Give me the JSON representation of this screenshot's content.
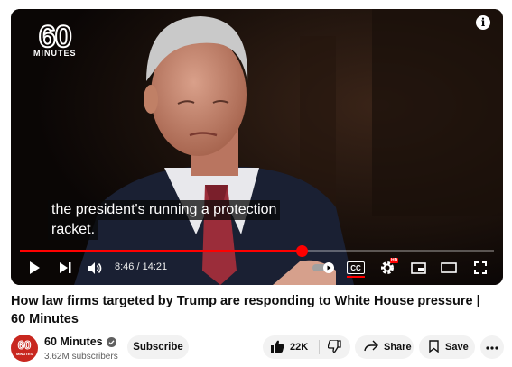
{
  "video": {
    "brand_number": "60",
    "brand_word": "MINUTES",
    "info_label": "i",
    "caption_line1": "the president's running a protection",
    "caption_line2": "racket.",
    "progress_fraction": 0.595,
    "current_time": "8:46",
    "duration": "14:21",
    "time_separator": "/",
    "cc_label": "CC",
    "hd_badge": "HD",
    "accent_color": "#ff0000"
  },
  "title": "How law firms targeted by Trump are responding to White House pressure | 60 Minutes",
  "channel": {
    "avatar_number": "60",
    "avatar_word": "MINUTES",
    "name": "60 Minutes",
    "subscribers": "3.62M subscribers",
    "avatar_color": "#c8271f"
  },
  "actions": {
    "subscribe": "Subscribe",
    "like_count": "22K",
    "share": "Share",
    "save": "Save"
  }
}
